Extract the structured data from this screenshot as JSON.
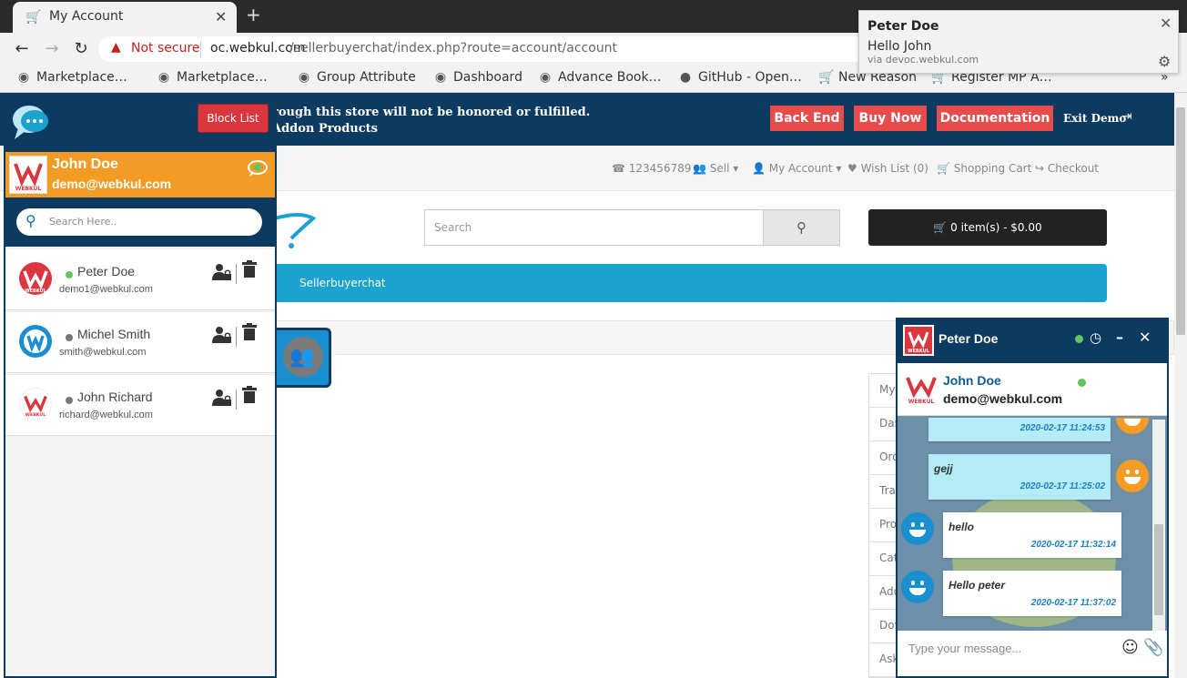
{
  "browser": {
    "tab_title": "My Account",
    "new_tab": "+",
    "address": {
      "security_label": "Not secure",
      "url_host": "oc.webkul.com",
      "url_path": "/sellerbuyerchat/index.php?route=account/account"
    },
    "bookmarks": [
      "Marketplace…",
      "Marketplace…",
      "Group Attribute",
      "Dashboard",
      "Advance Book…",
      "GitHub - Open…",
      "New Reason",
      "Register MP A…"
    ],
    "bookmarks_overflow": "»"
  },
  "notification": {
    "title": "Peter Doe",
    "message": "Hello John",
    "source": "via devoc.webkul.com"
  },
  "demo_bar": {
    "notice_line1": "rough this store will not be honored or fulfilled.",
    "notice_line2": "Addon Products",
    "buttons": [
      "Back End",
      "Buy Now",
      "Documentation"
    ],
    "exit": "Exit Demo"
  },
  "top_nav": {
    "phone": "123456789",
    "sell": "Sell",
    "my_account": "My Account",
    "wish_list": "Wish List (0)",
    "shopping_cart": "Shopping Cart",
    "checkout": "Checkout"
  },
  "store": {
    "search_placeholder": "Search",
    "cart_label": "0 item(s) - $0.00",
    "menu_item": "Sellerbuyerchat",
    "account_links": [
      "My",
      "Das",
      "Ord",
      "Tra",
      "Pro",
      "Cat",
      "Add",
      "Dov",
      "Ask"
    ]
  },
  "chat_sidebar": {
    "block_list_label": "Block List",
    "me": {
      "name": "John Doe",
      "email": "demo@webkul.com"
    },
    "search_placeholder": "Search Here..",
    "contacts": [
      {
        "name": "Peter Doe",
        "email": "demo1@webkul.com",
        "status": "online"
      },
      {
        "name": "Michel Smith",
        "email": "smith@webkul.com",
        "status": "offline"
      },
      {
        "name": "John Richard",
        "email": "richard@webkul.com",
        "status": "offline"
      }
    ]
  },
  "chat_window": {
    "title": "Peter Doe",
    "user_name": "John Doe",
    "user_email": "demo@webkul.com",
    "messages": [
      {
        "text": "",
        "time": "2020-02-17 11:24:53",
        "direction": "out"
      },
      {
        "text": "gejj",
        "time": "2020-02-17 11:25:02",
        "direction": "out"
      },
      {
        "text": "hello",
        "time": "2020-02-17 11:32:14",
        "direction": "in"
      },
      {
        "text": "Hello peter",
        "time": "2020-02-17 11:37:02",
        "direction": "in"
      }
    ],
    "input_placeholder": "Type your message..."
  },
  "colors": {
    "navy": "#0d3a61",
    "orange": "#f29c25",
    "demo_red": "#e74c4c",
    "menu_blue": "#1aa3cf",
    "online": "#62c462",
    "offline": "#777777"
  }
}
